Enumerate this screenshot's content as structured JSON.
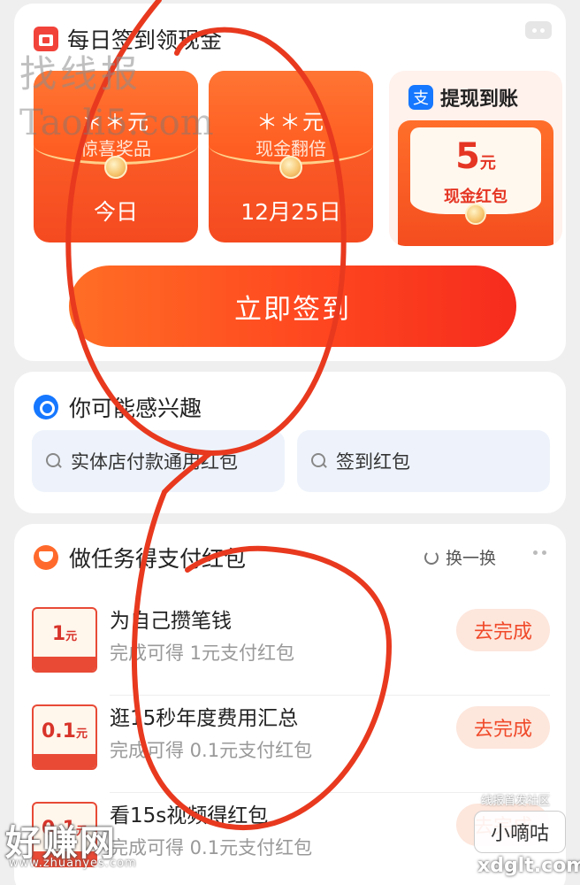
{
  "checkin": {
    "title": "每日签到领现金",
    "envelopes": [
      {
        "amount": "＊＊元",
        "label": "惊喜奖品",
        "day": "今日"
      },
      {
        "amount": "＊＊元",
        "label": "现金翻倍",
        "day": "12月25日"
      }
    ],
    "withdraw": {
      "title": "提现到账",
      "value": "5",
      "unit": "元",
      "label": "现金红包",
      "icon_text": "支"
    },
    "button_label": "立即签到"
  },
  "interest": {
    "title": "你可能感兴趣",
    "chips": [
      "实体店付款通用红包",
      "签到红包"
    ]
  },
  "tasks": {
    "title": "做任务得支付红包",
    "refresh_label": "换一换",
    "items": [
      {
        "thumb_value": "1",
        "thumb_unit": "元",
        "name": "为自己攒笔钱",
        "desc": "完成可得 1元支付红包",
        "action": "去完成"
      },
      {
        "thumb_value": "0.1",
        "thumb_unit": "元",
        "name": "逛15秒年度费用汇总",
        "desc": "完成可得 0.1元支付红包",
        "action": "去完成"
      },
      {
        "thumb_value": "0.1",
        "thumb_unit": "元",
        "name": "看15s视频得红包",
        "desc": "完成可得 0.1元支付红包",
        "action": "去完成"
      }
    ]
  },
  "watermarks": {
    "top_cn": "找线报",
    "top_en": "Taoli5.com",
    "bottom_cn": "好赚网",
    "bottom_url": "www.zhuanyes.com",
    "corner_small": "线报首发社区",
    "corner_box": "小嘀咕",
    "corner_url": "xdglt.com"
  },
  "colors": {
    "accent": "#ff4a20",
    "annotation": "#e8391f",
    "alipay": "#1677ff"
  }
}
